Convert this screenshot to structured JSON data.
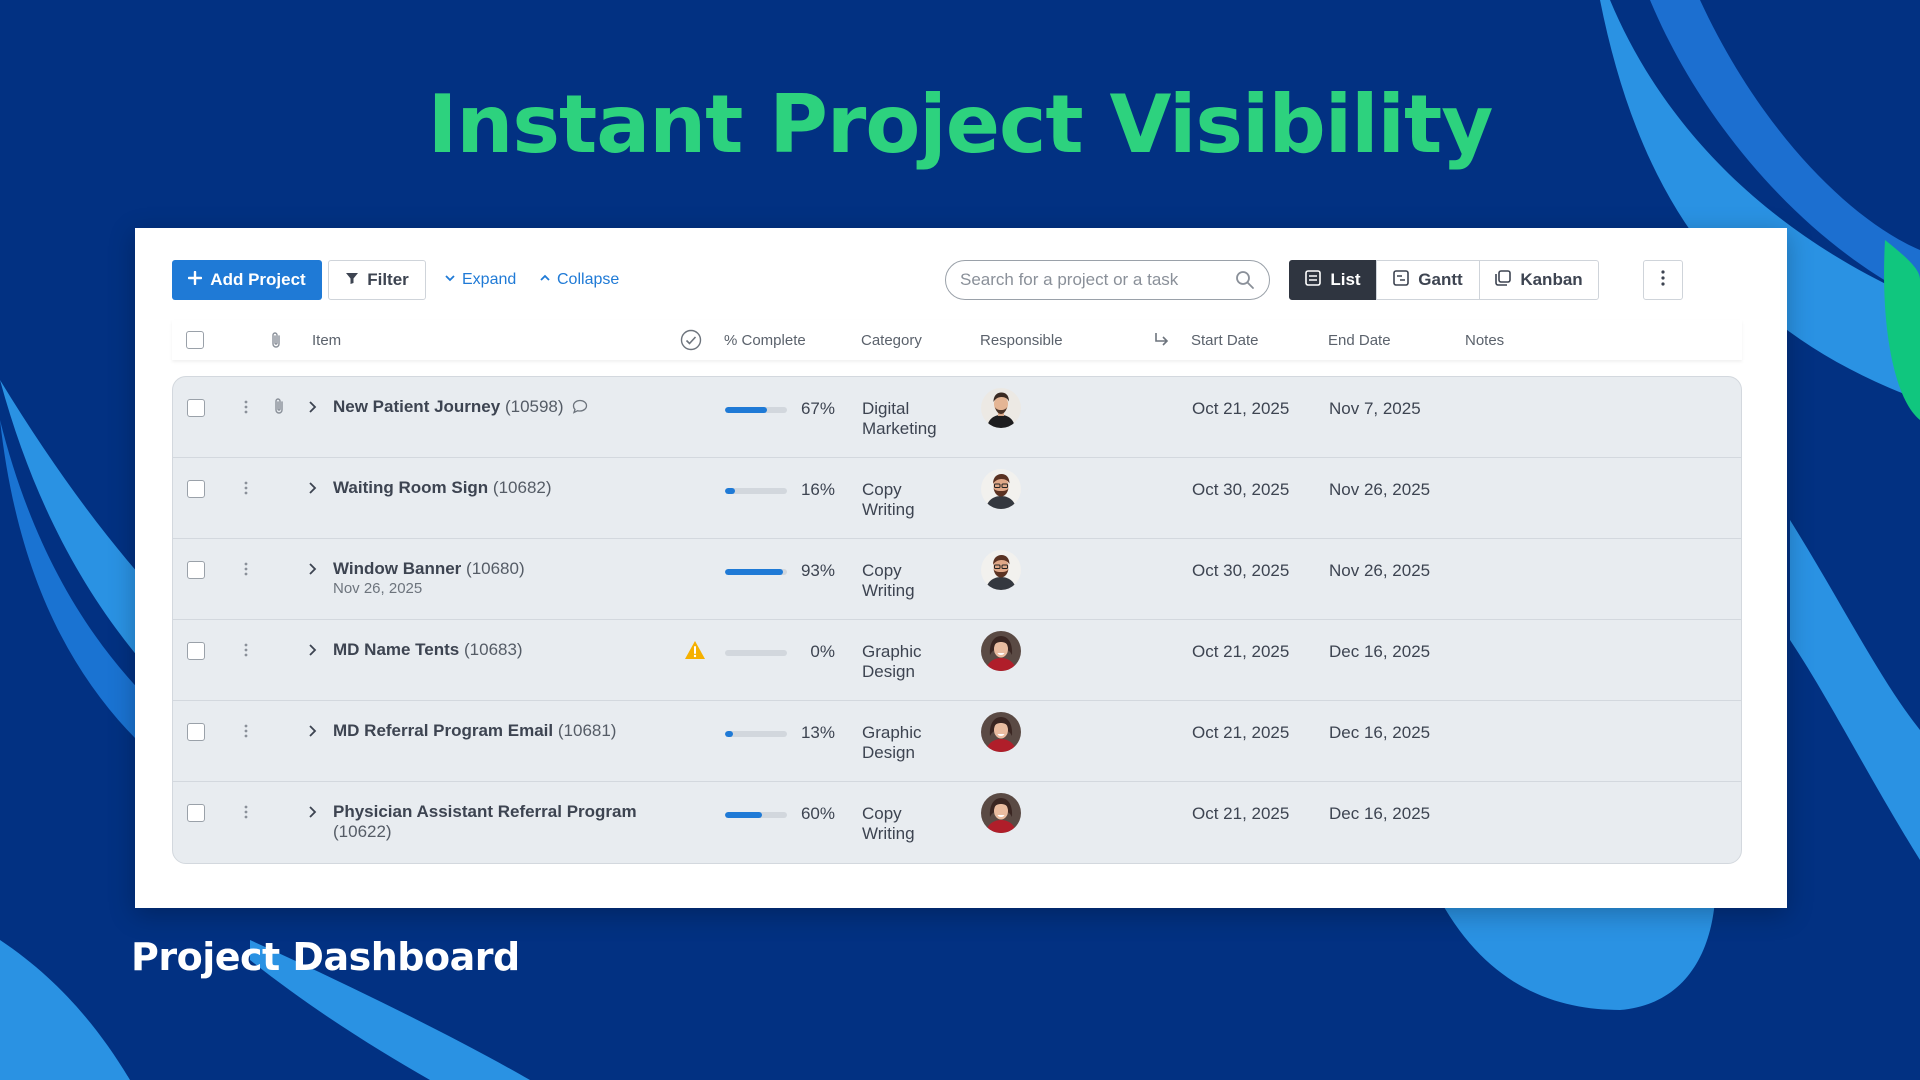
{
  "headline": "Instant Project Visibility",
  "caption": "Project Dashboard",
  "colors": {
    "background": "#023182",
    "accent_green": "#2dd27e",
    "primary_blue": "#1f7ad6",
    "active_view": "#2f3540"
  },
  "toolbar": {
    "add_project": "Add Project",
    "filter": "Filter",
    "expand": "Expand",
    "collapse": "Collapse",
    "search_placeholder": "Search for a project or a task",
    "views": {
      "list": "List",
      "gantt": "Gantt",
      "kanban": "Kanban"
    },
    "active_view": "list"
  },
  "columns": {
    "item": "Item",
    "complete": "% Complete",
    "category": "Category",
    "responsible": "Responsible",
    "start": "Start Date",
    "end": "End Date",
    "notes": "Notes"
  },
  "rows": [
    {
      "name": "New Patient Journey",
      "id": "(10598)",
      "sub": "",
      "has_attachment": true,
      "has_comment": true,
      "warning": false,
      "progress": 67,
      "progress_label": "67%",
      "category": [
        "Digital",
        "Marketing"
      ],
      "avatar": "person-1",
      "start": "Oct 21, 2025",
      "end": "Nov 7, 2025"
    },
    {
      "name": "Waiting Room Sign",
      "id": "(10682)",
      "sub": "",
      "has_attachment": false,
      "has_comment": false,
      "warning": false,
      "progress": 16,
      "progress_label": "16%",
      "category": [
        "Copy",
        "Writing"
      ],
      "avatar": "person-2",
      "start": "Oct 30, 2025",
      "end": "Nov 26, 2025"
    },
    {
      "name": "Window Banner",
      "id": "(10680)",
      "sub": "Nov 26, 2025",
      "has_attachment": false,
      "has_comment": false,
      "warning": false,
      "progress": 93,
      "progress_label": "93%",
      "category": [
        "Copy",
        "Writing"
      ],
      "avatar": "person-2",
      "start": "Oct 30, 2025",
      "end": "Nov 26, 2025"
    },
    {
      "name": "MD Name Tents",
      "id": "(10683)",
      "sub": "",
      "has_attachment": false,
      "has_comment": false,
      "warning": true,
      "progress": 0,
      "progress_label": "0%",
      "category": [
        "Graphic",
        "Design"
      ],
      "avatar": "person-3",
      "start": "Oct 21, 2025",
      "end": "Dec 16, 2025"
    },
    {
      "name": "MD Referral Program Email",
      "id": "(10681)",
      "sub": "",
      "has_attachment": false,
      "has_comment": false,
      "warning": false,
      "progress": 13,
      "progress_label": "13%",
      "category": [
        "Graphic",
        "Design"
      ],
      "avatar": "person-3",
      "start": "Oct 21, 2025",
      "end": "Dec 16, 2025"
    },
    {
      "name": "Physician Assistant Referral Program",
      "id": "(10622)",
      "sub": "",
      "has_attachment": false,
      "has_comment": false,
      "warning": false,
      "progress": 60,
      "progress_label": "60%",
      "category": [
        "Copy",
        "Writing"
      ],
      "avatar": "person-3",
      "start": "Oct 21, 2025",
      "end": "Dec 16, 2025"
    }
  ]
}
